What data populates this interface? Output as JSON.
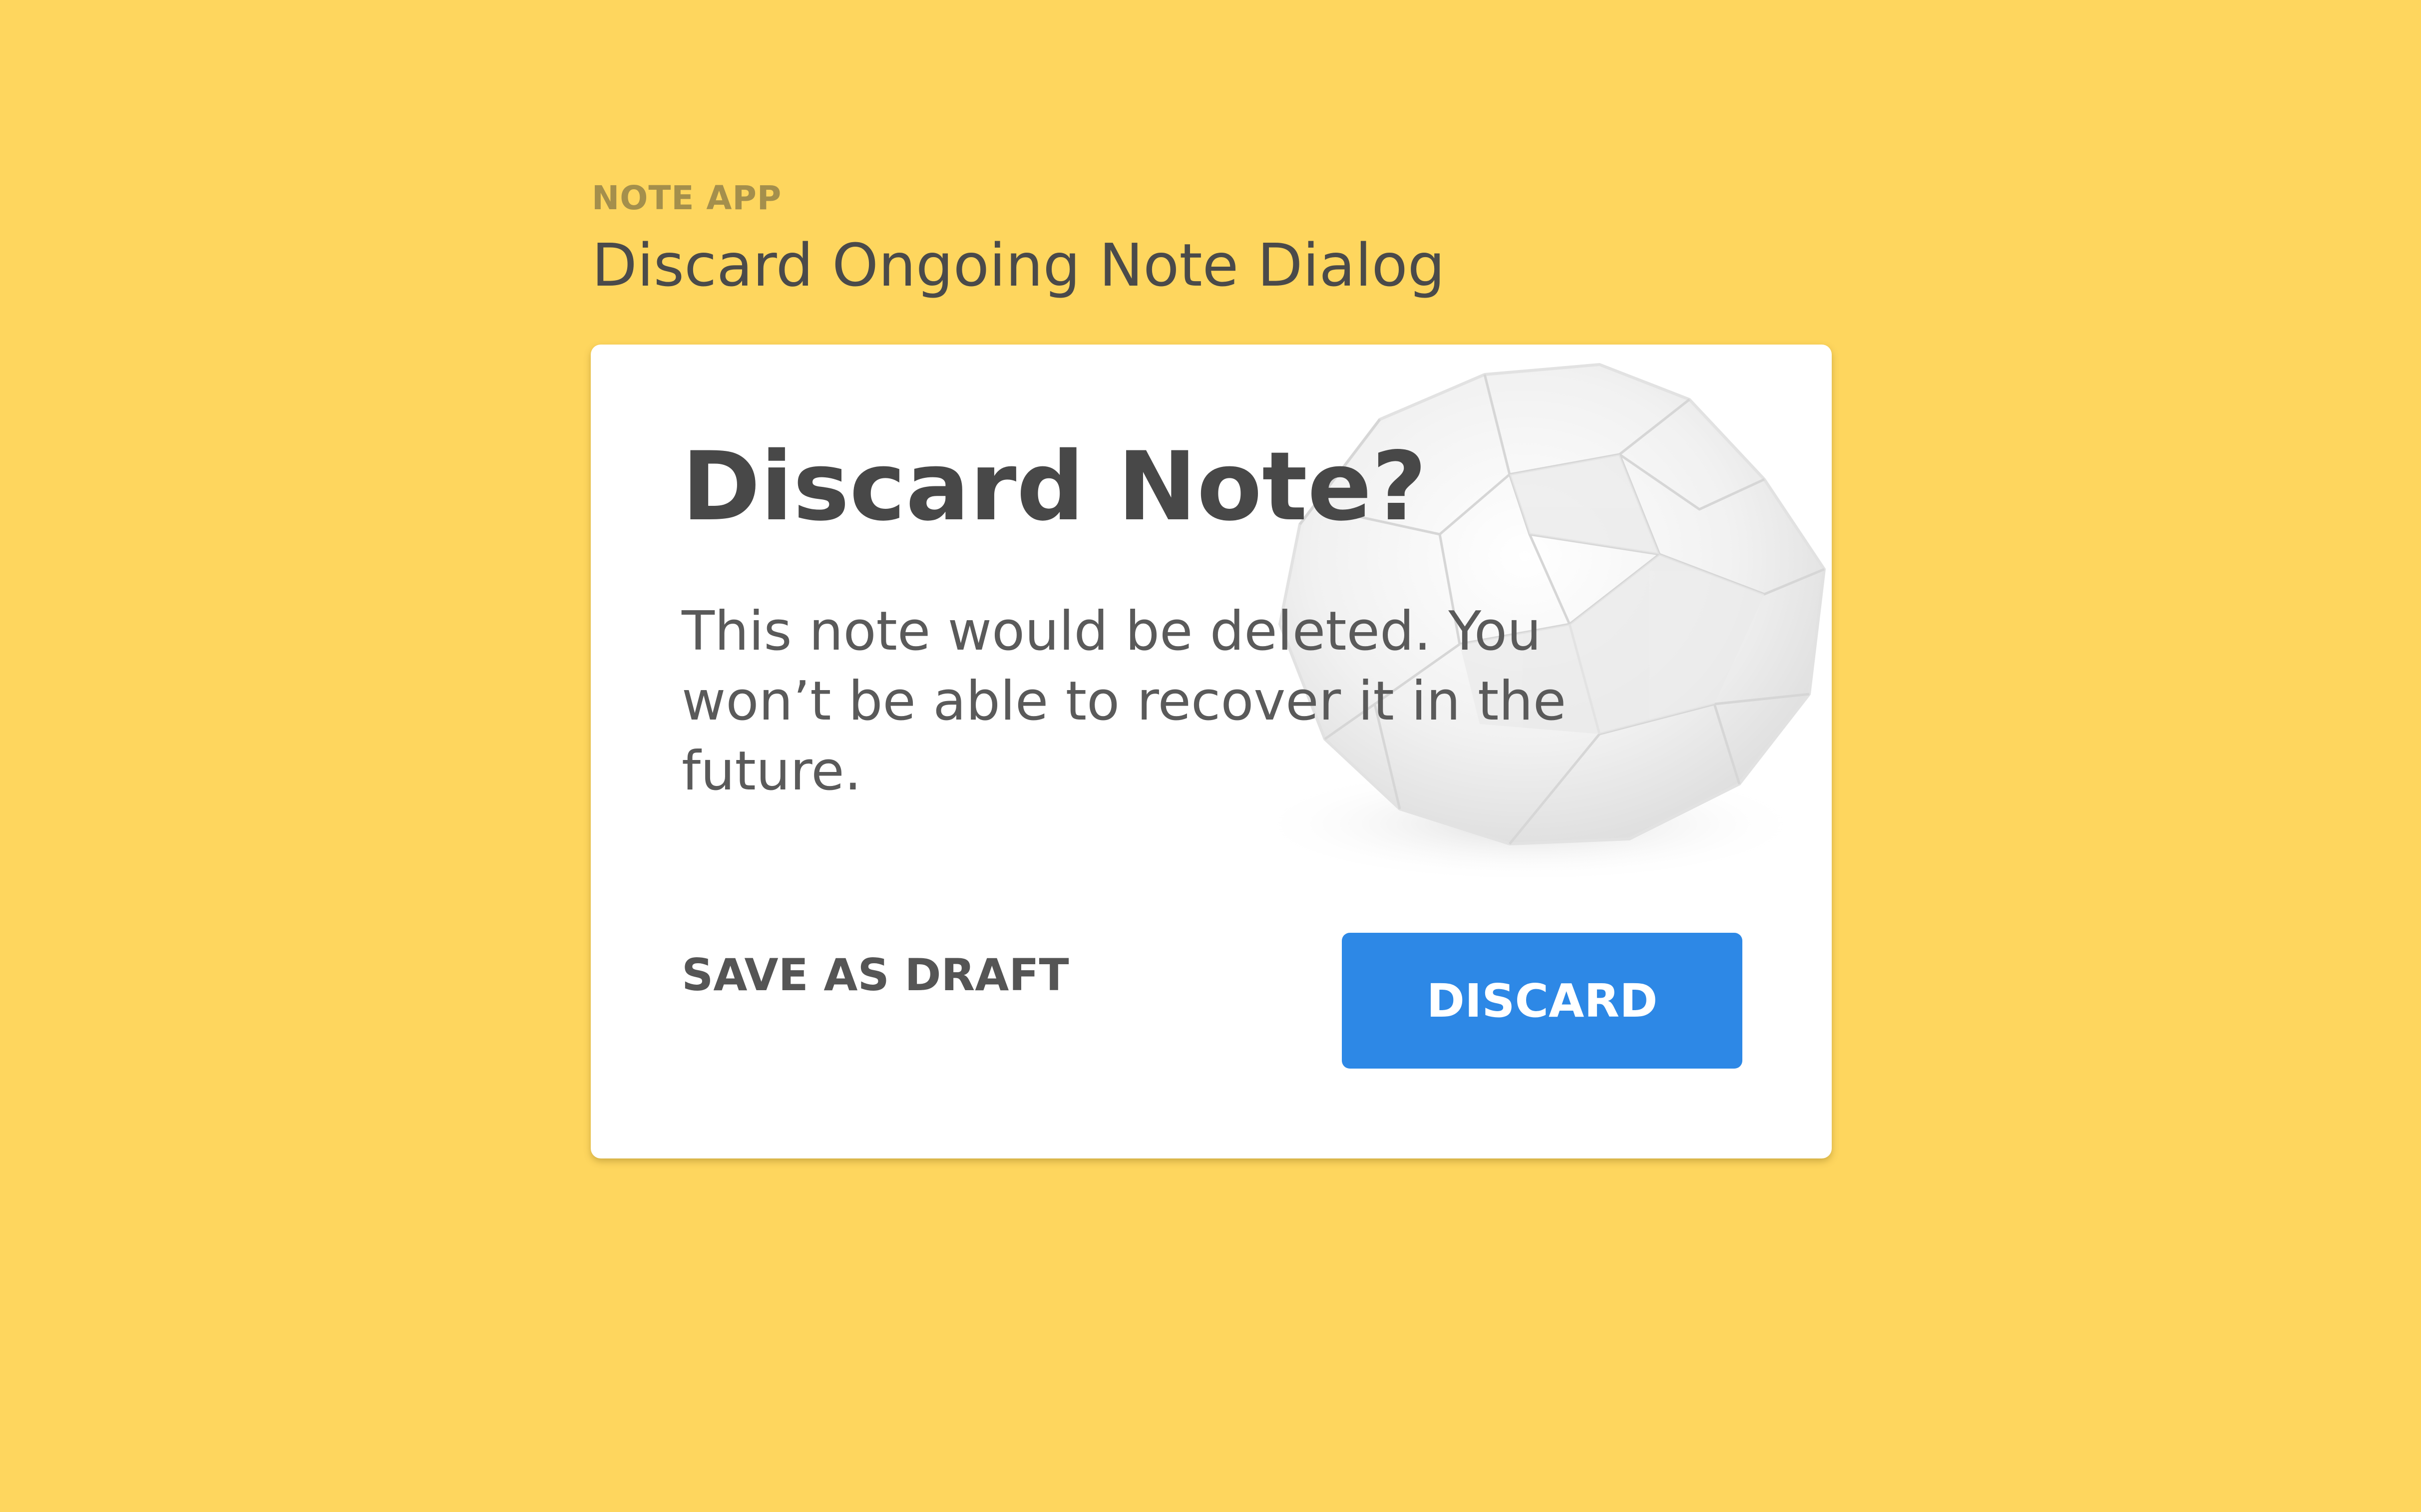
{
  "app": {
    "name": "NOTE APP",
    "screen_title": "Discard Ongoing Note Dialog"
  },
  "dialog": {
    "title": "Discard Note?",
    "message": "This note would be deleted. You won’t be able to recover it in the future.",
    "secondary_action_label": "SAVE AS DRAFT",
    "primary_action_label": "DISCARD",
    "illustration": "crumpled-paper-ball"
  },
  "colors": {
    "background": "#FED65E",
    "dialog_background": "#FFFFFF",
    "primary_button": "#2D88E6",
    "title_text": "#484848",
    "body_text": "#5A5A5A",
    "eyebrow_text": "#A48F4C"
  }
}
